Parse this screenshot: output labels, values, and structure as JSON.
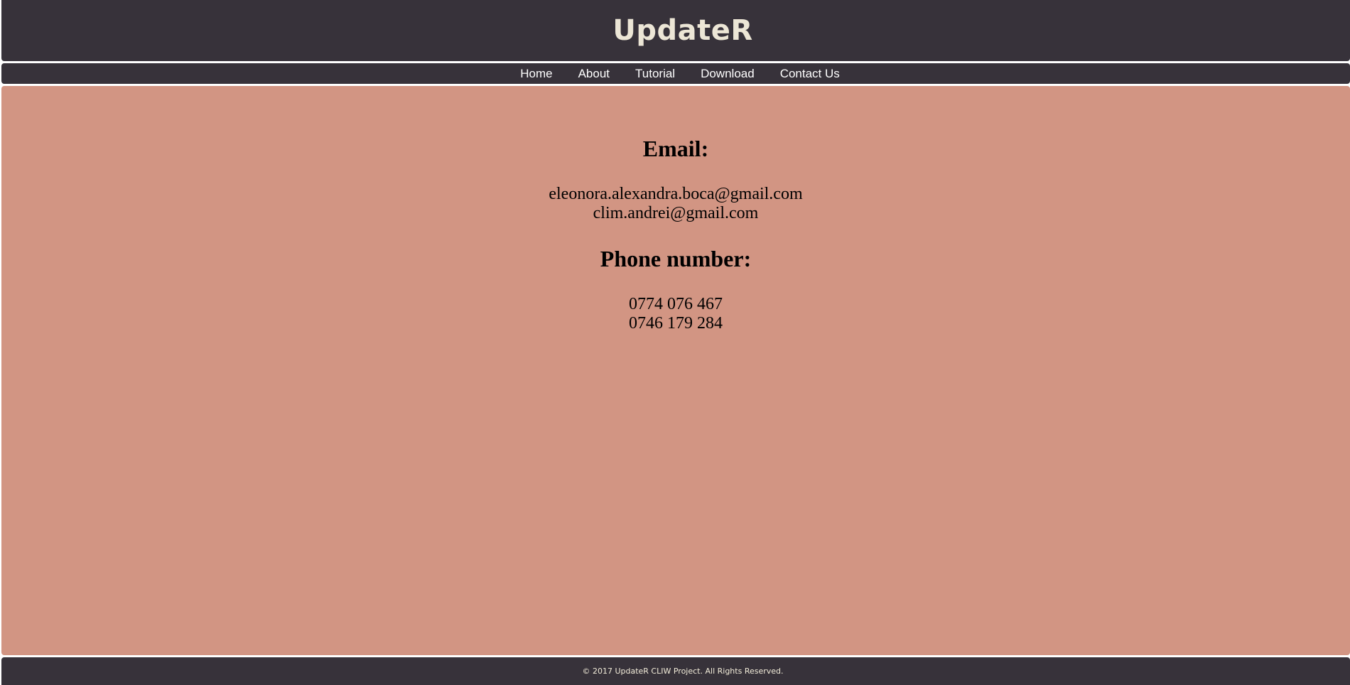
{
  "header": {
    "title": "UpdateR"
  },
  "nav": {
    "items": [
      {
        "label": "Home"
      },
      {
        "label": "About"
      },
      {
        "label": "Tutorial"
      },
      {
        "label": "Download"
      },
      {
        "label": "Contact Us"
      }
    ]
  },
  "contact": {
    "email_heading": "Email:",
    "emails": [
      "eleonora.alexandra.boca@gmail.com",
      "clim.andrei@gmail.com"
    ],
    "phone_heading": "Phone number:",
    "phones": [
      "0774 076 467",
      "0746 179 284"
    ]
  },
  "footer": {
    "copyright": "© 2017 UpdateR CLIW Project. All Rights Reserved."
  },
  "colors": {
    "header_bg": "#37323a",
    "title_color": "#ece6d6",
    "content_bg": "#d29583",
    "nav_text": "#ffffff"
  }
}
